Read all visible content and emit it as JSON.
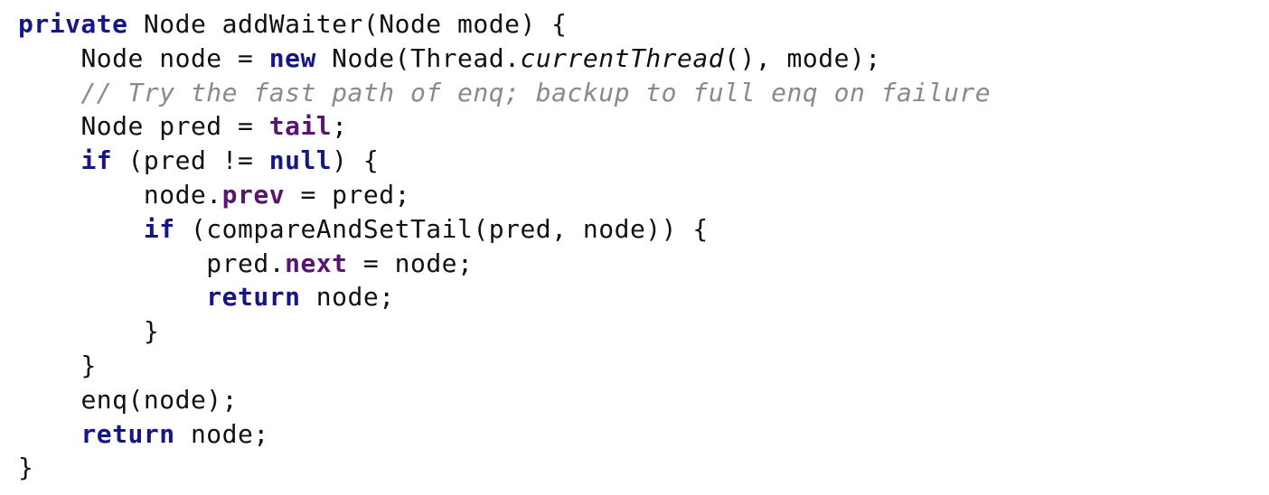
{
  "code": {
    "l1": {
      "kw1": "private",
      "t1": " Node addWaiter(Node mode) {"
    },
    "l2": {
      "t1": "Node node = ",
      "kw1": "new",
      "t2": " Node(Thread.",
      "mtd1": "currentThread",
      "t3": "(), mode);"
    },
    "l3": {
      "cmt": "// Try the fast path of enq; backup to full enq on failure"
    },
    "l4": {
      "t1": "Node pred = ",
      "fld1": "tail",
      "t2": ";"
    },
    "l5": {
      "kw1": "if",
      "t1": " (pred != ",
      "kw2": "null",
      "t2": ") {"
    },
    "l6": {
      "t1": "node.",
      "fld1": "prev",
      "t2": " = pred;"
    },
    "l7": {
      "kw1": "if",
      "t1": " (compareAndSetTail(pred, node)) {"
    },
    "l8": {
      "t1": "pred.",
      "fld1": "next",
      "t2": " = node;"
    },
    "l9": {
      "kw1": "return",
      "t1": " node;"
    },
    "l10": {
      "t1": "}"
    },
    "l11": {
      "t1": "}"
    },
    "l12": {
      "t1": "enq(node);"
    },
    "l13": {
      "kw1": "return",
      "t1": " node;"
    },
    "l14": {
      "t1": "}"
    }
  },
  "indents": {
    "i0": "",
    "i1": "    ",
    "i2": "        ",
    "i3": "            "
  }
}
